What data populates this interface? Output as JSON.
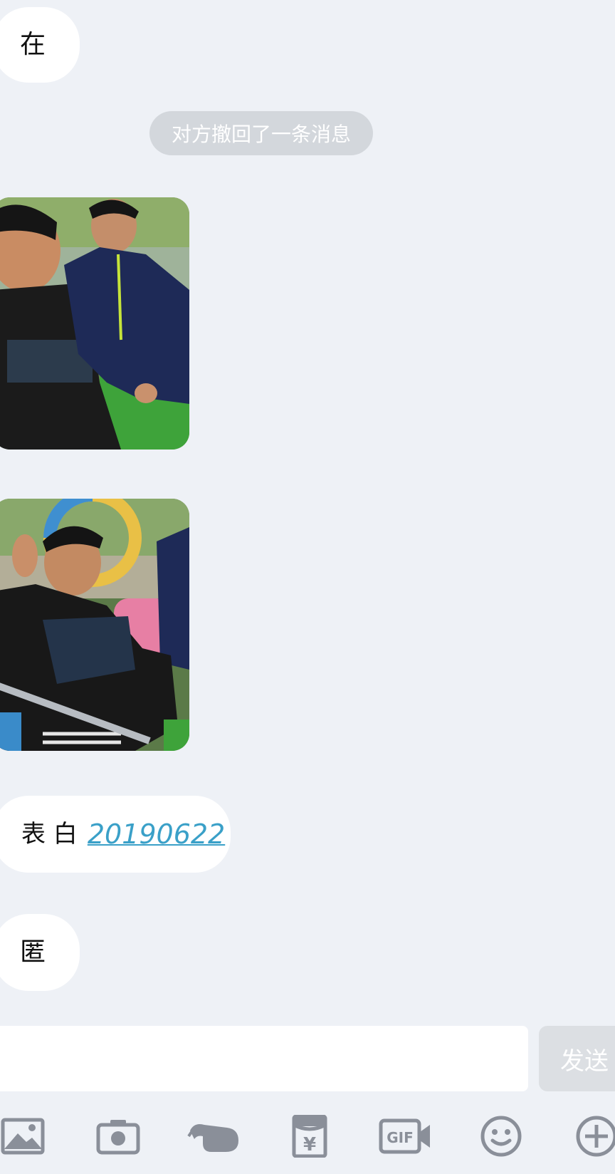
{
  "messages": [
    {
      "type": "text",
      "text": "在"
    },
    {
      "type": "system",
      "text": "对方撤回了一条消息"
    },
    {
      "type": "image"
    },
    {
      "type": "image"
    },
    {
      "type": "text",
      "prefix": "表 白",
      "link": "20190622"
    },
    {
      "type": "text",
      "text": "匿"
    }
  ],
  "input": {
    "value": "",
    "placeholder": ""
  },
  "send_label": "发送",
  "toolbar": {
    "icons": [
      "image-icon",
      "camera-icon",
      "poke-icon",
      "red-packet-icon",
      "gif-icon",
      "emoji-icon",
      "plus-icon"
    ]
  },
  "colors": {
    "background": "#eef1f6",
    "bubble": "#ffffff",
    "system_note": "#d3d7dc",
    "link": "#3aa0c8",
    "icon": "#8a8f99"
  }
}
